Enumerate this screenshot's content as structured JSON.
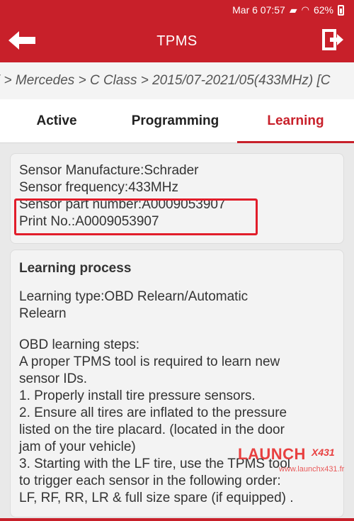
{
  "status_bar": {
    "date_time": "Mar 6 07:57",
    "battery": "62%"
  },
  "app_bar": {
    "title": "TPMS"
  },
  "breadcrumb": "i > Mercedes > C Class > 2015/07-2021/05(433MHz) [C",
  "tabs": [
    {
      "label": "Active",
      "selected": false
    },
    {
      "label": "Programming",
      "selected": false
    },
    {
      "label": "Learning",
      "selected": true
    }
  ],
  "sensor_info": {
    "manufacture": "Sensor Manufacture:Schrader",
    "frequency": "Sensor frequency:433MHz",
    "part_number": "Sensor part number:A0009053907",
    "print_no": "Print No.:A0009053907"
  },
  "learning": {
    "heading": "Learning process",
    "type_line1": "Learning type:OBD Relearn/Automatic",
    "type_line2": "Relearn",
    "steps": [
      "OBD learning steps:",
      "A proper TPMS tool is required to learn new",
      "sensor IDs.",
      "1. Properly install tire pressure sensors.",
      "2. Ensure all tires are inflated to the pressure",
      "listed on the tire placard. (located in the door",
      "jam of your vehicle)",
      "3. Starting with the LF tire, use the TPMS tool",
      "to trigger each sensor in the following order:",
      "LF, RF, RR, LR & full size spare (if equipped) ."
    ]
  },
  "watermark": {
    "brand": "LAUNCH",
    "model": "X431",
    "site": "www.launchx431.fr"
  },
  "colors": {
    "brand_red": "#c8202a",
    "highlight": "#e11d2a"
  }
}
